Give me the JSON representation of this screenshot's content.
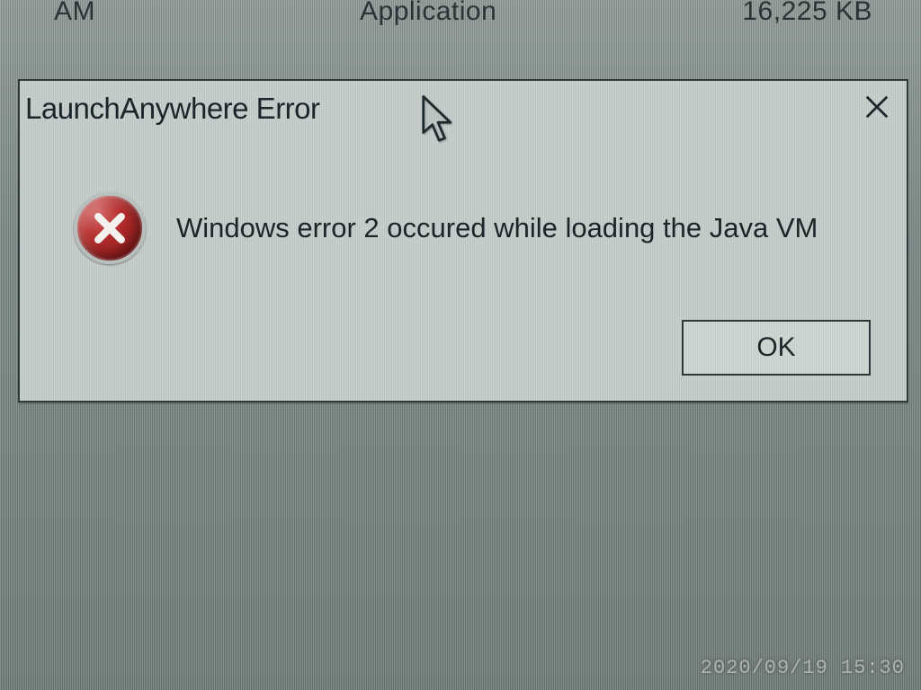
{
  "background_row": {
    "date_fragment": "AM",
    "type": "Application",
    "size": "16,225 KB"
  },
  "dialog": {
    "title": "LaunchAnywhere Error",
    "message": "Windows error 2 occured while loading the Java VM",
    "ok_label": "OK",
    "icon_name": "error-x-icon"
  },
  "camera_timestamp": "2020/09/19 15:30"
}
